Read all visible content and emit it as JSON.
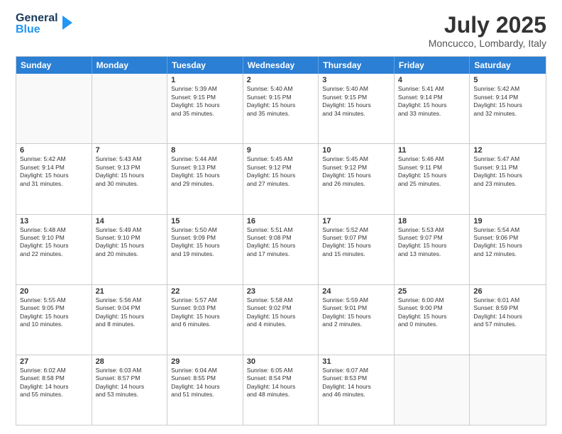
{
  "header": {
    "logo_general": "General",
    "logo_blue": "Blue",
    "month_title": "July 2025",
    "location": "Moncucco, Lombardy, Italy"
  },
  "days_of_week": [
    "Sunday",
    "Monday",
    "Tuesday",
    "Wednesday",
    "Thursday",
    "Friday",
    "Saturday"
  ],
  "weeks": [
    [
      {
        "day": "",
        "lines": []
      },
      {
        "day": "",
        "lines": []
      },
      {
        "day": "1",
        "lines": [
          "Sunrise: 5:39 AM",
          "Sunset: 9:15 PM",
          "Daylight: 15 hours",
          "and 35 minutes."
        ]
      },
      {
        "day": "2",
        "lines": [
          "Sunrise: 5:40 AM",
          "Sunset: 9:15 PM",
          "Daylight: 15 hours",
          "and 35 minutes."
        ]
      },
      {
        "day": "3",
        "lines": [
          "Sunrise: 5:40 AM",
          "Sunset: 9:15 PM",
          "Daylight: 15 hours",
          "and 34 minutes."
        ]
      },
      {
        "day": "4",
        "lines": [
          "Sunrise: 5:41 AM",
          "Sunset: 9:14 PM",
          "Daylight: 15 hours",
          "and 33 minutes."
        ]
      },
      {
        "day": "5",
        "lines": [
          "Sunrise: 5:42 AM",
          "Sunset: 9:14 PM",
          "Daylight: 15 hours",
          "and 32 minutes."
        ]
      }
    ],
    [
      {
        "day": "6",
        "lines": [
          "Sunrise: 5:42 AM",
          "Sunset: 9:14 PM",
          "Daylight: 15 hours",
          "and 31 minutes."
        ]
      },
      {
        "day": "7",
        "lines": [
          "Sunrise: 5:43 AM",
          "Sunset: 9:13 PM",
          "Daylight: 15 hours",
          "and 30 minutes."
        ]
      },
      {
        "day": "8",
        "lines": [
          "Sunrise: 5:44 AM",
          "Sunset: 9:13 PM",
          "Daylight: 15 hours",
          "and 29 minutes."
        ]
      },
      {
        "day": "9",
        "lines": [
          "Sunrise: 5:45 AM",
          "Sunset: 9:12 PM",
          "Daylight: 15 hours",
          "and 27 minutes."
        ]
      },
      {
        "day": "10",
        "lines": [
          "Sunrise: 5:45 AM",
          "Sunset: 9:12 PM",
          "Daylight: 15 hours",
          "and 26 minutes."
        ]
      },
      {
        "day": "11",
        "lines": [
          "Sunrise: 5:46 AM",
          "Sunset: 9:11 PM",
          "Daylight: 15 hours",
          "and 25 minutes."
        ]
      },
      {
        "day": "12",
        "lines": [
          "Sunrise: 5:47 AM",
          "Sunset: 9:11 PM",
          "Daylight: 15 hours",
          "and 23 minutes."
        ]
      }
    ],
    [
      {
        "day": "13",
        "lines": [
          "Sunrise: 5:48 AM",
          "Sunset: 9:10 PM",
          "Daylight: 15 hours",
          "and 22 minutes."
        ]
      },
      {
        "day": "14",
        "lines": [
          "Sunrise: 5:49 AM",
          "Sunset: 9:10 PM",
          "Daylight: 15 hours",
          "and 20 minutes."
        ]
      },
      {
        "day": "15",
        "lines": [
          "Sunrise: 5:50 AM",
          "Sunset: 9:09 PM",
          "Daylight: 15 hours",
          "and 19 minutes."
        ]
      },
      {
        "day": "16",
        "lines": [
          "Sunrise: 5:51 AM",
          "Sunset: 9:08 PM",
          "Daylight: 15 hours",
          "and 17 minutes."
        ]
      },
      {
        "day": "17",
        "lines": [
          "Sunrise: 5:52 AM",
          "Sunset: 9:07 PM",
          "Daylight: 15 hours",
          "and 15 minutes."
        ]
      },
      {
        "day": "18",
        "lines": [
          "Sunrise: 5:53 AM",
          "Sunset: 9:07 PM",
          "Daylight: 15 hours",
          "and 13 minutes."
        ]
      },
      {
        "day": "19",
        "lines": [
          "Sunrise: 5:54 AM",
          "Sunset: 9:06 PM",
          "Daylight: 15 hours",
          "and 12 minutes."
        ]
      }
    ],
    [
      {
        "day": "20",
        "lines": [
          "Sunrise: 5:55 AM",
          "Sunset: 9:05 PM",
          "Daylight: 15 hours",
          "and 10 minutes."
        ]
      },
      {
        "day": "21",
        "lines": [
          "Sunrise: 5:56 AM",
          "Sunset: 9:04 PM",
          "Daylight: 15 hours",
          "and 8 minutes."
        ]
      },
      {
        "day": "22",
        "lines": [
          "Sunrise: 5:57 AM",
          "Sunset: 9:03 PM",
          "Daylight: 15 hours",
          "and 6 minutes."
        ]
      },
      {
        "day": "23",
        "lines": [
          "Sunrise: 5:58 AM",
          "Sunset: 9:02 PM",
          "Daylight: 15 hours",
          "and 4 minutes."
        ]
      },
      {
        "day": "24",
        "lines": [
          "Sunrise: 5:59 AM",
          "Sunset: 9:01 PM",
          "Daylight: 15 hours",
          "and 2 minutes."
        ]
      },
      {
        "day": "25",
        "lines": [
          "Sunrise: 6:00 AM",
          "Sunset: 9:00 PM",
          "Daylight: 15 hours",
          "and 0 minutes."
        ]
      },
      {
        "day": "26",
        "lines": [
          "Sunrise: 6:01 AM",
          "Sunset: 8:59 PM",
          "Daylight: 14 hours",
          "and 57 minutes."
        ]
      }
    ],
    [
      {
        "day": "27",
        "lines": [
          "Sunrise: 6:02 AM",
          "Sunset: 8:58 PM",
          "Daylight: 14 hours",
          "and 55 minutes."
        ]
      },
      {
        "day": "28",
        "lines": [
          "Sunrise: 6:03 AM",
          "Sunset: 8:57 PM",
          "Daylight: 14 hours",
          "and 53 minutes."
        ]
      },
      {
        "day": "29",
        "lines": [
          "Sunrise: 6:04 AM",
          "Sunset: 8:55 PM",
          "Daylight: 14 hours",
          "and 51 minutes."
        ]
      },
      {
        "day": "30",
        "lines": [
          "Sunrise: 6:05 AM",
          "Sunset: 8:54 PM",
          "Daylight: 14 hours",
          "and 48 minutes."
        ]
      },
      {
        "day": "31",
        "lines": [
          "Sunrise: 6:07 AM",
          "Sunset: 8:53 PM",
          "Daylight: 14 hours",
          "and 46 minutes."
        ]
      },
      {
        "day": "",
        "lines": []
      },
      {
        "day": "",
        "lines": []
      }
    ]
  ]
}
